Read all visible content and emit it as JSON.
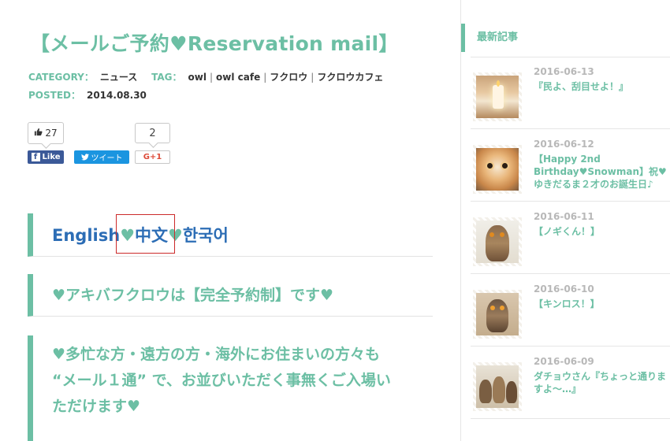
{
  "article": {
    "title": "【メールご予約♥Reservation mail】",
    "category_label": "CATEGORY：",
    "category_value": "ニュース",
    "tag_label": "TAG：",
    "tags": [
      "owl",
      "owl cafe",
      "フクロウ",
      "フクロウカフェ"
    ],
    "tag_separator": "|",
    "posted_label": "POSTED：",
    "posted_date": "2014.08.30"
  },
  "social": {
    "like_count": "27",
    "facebook_label": "Like",
    "facebook_f": "f",
    "tweet_label": "ツイート",
    "gplus_count": "2",
    "gplus_label": "G+1"
  },
  "sections": {
    "languages": {
      "english": "English",
      "heart": "♥",
      "chinese": "中文",
      "korean": "한국어"
    },
    "reservation_heading": "♥アキバフクロウは【完全予約制】です♥",
    "busy_lines": [
      "♥多忙な方・遠方の方・海外にお住まいの方々も",
      "“メール１通” で、お並びいただく事無くご入場い",
      "ただけます♥"
    ]
  },
  "sidebar": {
    "title": "最新記事",
    "posts": [
      {
        "date": "2016-06-13",
        "title": "『民よ、刮目せよ！』",
        "thumb": "candle-photo"
      },
      {
        "date": "2016-06-12",
        "title": "【Happy 2nd Birthday♥Snowman】祝♥ゆきだるま２才のお誕生日♪",
        "thumb": "owl-face-photo"
      },
      {
        "date": "2016-06-11",
        "title": "【ノギくん！】",
        "thumb": "owl-photo"
      },
      {
        "date": "2016-06-10",
        "title": "【キンロス！】",
        "thumb": "owl-photo"
      },
      {
        "date": "2016-06-09",
        "title": "ダチョウさん『ちょっと通りますよ〜…』",
        "thumb": "owl-group-photo"
      }
    ]
  },
  "colors": {
    "accent": "#6cbfa4",
    "link": "#2c6db5",
    "facebook": "#3b5998",
    "twitter": "#1b95e0",
    "highlight": "#cc2a2a"
  }
}
